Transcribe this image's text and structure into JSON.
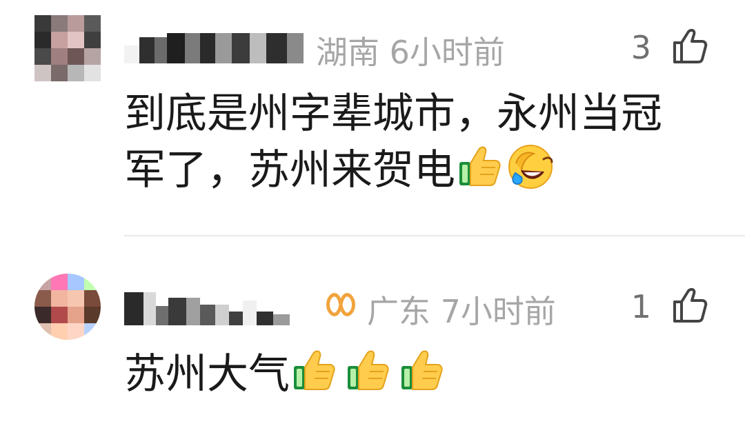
{
  "comments": [
    {
      "location": "湖南",
      "time": "6小时前",
      "likes": "3",
      "line1": "到底是州字辈城市，永州当冠",
      "line2": "军了，苏州来贺电",
      "emojis": [
        "thumbs-up",
        "face-palm-laugh"
      ]
    },
    {
      "location": "广东",
      "time": "7小时前",
      "likes": "1",
      "line1": "苏州大气",
      "emojis": [
        "thumbs-up",
        "thumbs-up",
        "thumbs-up"
      ]
    }
  ],
  "colors": {
    "meta": "#a6a6a6",
    "likes": "#707070",
    "text": "#1a1a1a",
    "badge": "#f2a33c",
    "divider": "#e9e9e9"
  }
}
